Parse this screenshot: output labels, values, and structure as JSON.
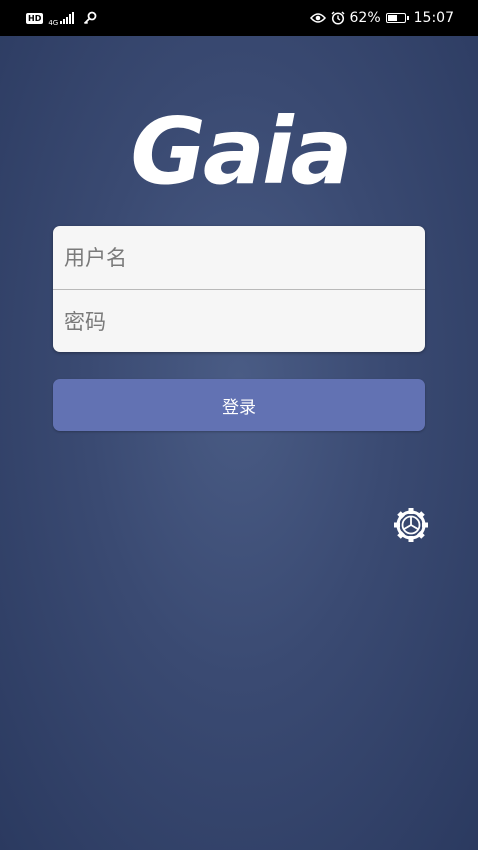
{
  "status_bar": {
    "hd_label": "HD",
    "network_gen": "4G",
    "battery_percent": "62%",
    "battery_level": 0.62,
    "time": "15:07",
    "icons": [
      "hd-icon",
      "signal-icon",
      "key-icon",
      "eye-icon",
      "alarm-icon",
      "battery-icon"
    ]
  },
  "logo": {
    "text": "Gaia"
  },
  "form": {
    "username_placeholder": "用户名",
    "password_placeholder": "密码",
    "username_value": "",
    "password_value": ""
  },
  "login_button": {
    "label": "登录"
  },
  "settings": {
    "icon": "gear-icon"
  },
  "colors": {
    "background": "#3a4a72",
    "button": "#6272b3",
    "input_bg": "#f6f6f6",
    "status_bar": "#000000"
  }
}
